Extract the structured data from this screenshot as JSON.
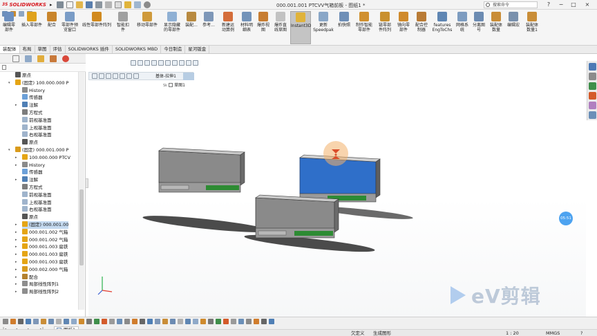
{
  "app": {
    "brand": "SOLIDWORKS",
    "window_title": "000.001.001 PTCVV气箱前板 - 图纸1 *",
    "search_placeholder": "搜索命令",
    "window_controls": [
      "?",
      "−",
      "□",
      "×"
    ]
  },
  "ribbon": {
    "buttons": [
      {
        "label": "编辑零\n部件",
        "icon": "edit-component-icon",
        "color": "#6c8fbf"
      },
      {
        "label": "插入零部件",
        "icon": "insert-components-icon",
        "color": "#e0a21c"
      },
      {
        "label": "配合",
        "icon": "mate-icon",
        "color": "#c9852b"
      },
      {
        "label": "零部件预\n览窗口",
        "icon": "component-preview-icon",
        "color": "#7a9cc6"
      },
      {
        "label": "线性零部件阵列",
        "icon": "linear-pattern-icon",
        "color": "#d18a1f"
      },
      {
        "label": "智能扣\n件",
        "icon": "smart-fasteners-icon",
        "color": "#a0a0a0"
      },
      {
        "label": "移动零部件",
        "icon": "move-component-icon",
        "color": "#cf9a3b"
      },
      {
        "label": "显示隐藏\n的零部件",
        "icon": "show-hidden-icon",
        "color": "#8fb0d4"
      },
      {
        "label": "装配...",
        "icon": "assembly-features-icon",
        "color": "#b88a40"
      },
      {
        "label": "参考...",
        "icon": "reference-geometry-icon",
        "color": "#7e97b8"
      },
      {
        "label": "新建运\n动算例",
        "icon": "new-motion-study-icon",
        "color": "#d46d3a"
      },
      {
        "label": "材料明\n细表",
        "icon": "bom-icon",
        "color": "#7393b9"
      },
      {
        "label": "爆炸视\n图",
        "icon": "exploded-view-icon",
        "color": "#c77d32"
      },
      {
        "label": "爆炸直\n线草图",
        "icon": "explode-line-sketch-icon",
        "color": "#c2c2c2"
      },
      {
        "label": "Instant3D",
        "icon": "instant3d-icon",
        "color": "#e0b33a",
        "active": true
      },
      {
        "label": "更新\nSpeedpak",
        "icon": "speedpak-icon",
        "color": "#8aa7c7"
      },
      {
        "label": "拍快照",
        "icon": "snapshot-icon",
        "color": "#6f8fb7"
      },
      {
        "label": "制作智能\n零部件",
        "icon": "smart-component-icon",
        "color": "#d0902f"
      },
      {
        "label": "链零部\n件阵列",
        "icon": "chain-pattern-icon",
        "color": "#c9902e"
      },
      {
        "label": "镜向零\n部件",
        "icon": "mirror-components-icon",
        "color": "#cf8a2c"
      },
      {
        "label": "配合控\n制器",
        "icon": "mate-controller-icon",
        "color": "#b97b35"
      },
      {
        "label": "features\nEngToChs",
        "icon": "features-translate-icon",
        "color": "#5f86b3"
      },
      {
        "label": "网格系\n统",
        "icon": "grid-system-icon",
        "color": "#7d9cc0"
      },
      {
        "label": "分离图\n号",
        "icon": "split-number-icon",
        "color": "#6c8bb2"
      },
      {
        "label": "装配体\n数量",
        "icon": "assembly-count-icon",
        "color": "#c98d37"
      },
      {
        "label": "编辑宏",
        "icon": "edit-macro-icon",
        "color": "#7a91ad"
      },
      {
        "label": "装配体\n数量1",
        "icon": "assembly-count-1-icon",
        "color": "#c98d37"
      }
    ]
  },
  "tabs": [
    {
      "label": "装配体",
      "active": true
    },
    {
      "label": "布局"
    },
    {
      "label": "草图"
    },
    {
      "label": "评估"
    },
    {
      "label": "SOLIDWORKS 插件"
    },
    {
      "label": "SOLIDWORKS MBD"
    },
    {
      "label": "今日制造"
    },
    {
      "label": "星河钣金"
    }
  ],
  "tree": {
    "nodes": [
      {
        "label": "原点",
        "indent": 0,
        "icon": "origin-icon",
        "color": "#555555"
      },
      {
        "label": "(固定) 100.000.000 P",
        "indent": 0,
        "icon": "part-icon",
        "color": "#e5a514",
        "expander": "▾"
      },
      {
        "label": "History",
        "indent": 1,
        "icon": "history-icon",
        "color": "#8a8a8a"
      },
      {
        "label": "传感器",
        "indent": 1,
        "icon": "sensor-icon",
        "color": "#6ca0d8"
      },
      {
        "label": "注解",
        "indent": 1,
        "icon": "annotations-icon",
        "color": "#4f7fb5",
        "expander": "▸"
      },
      {
        "label": "方程式",
        "indent": 1,
        "icon": "equations-icon",
        "color": "#7d7d7d"
      },
      {
        "label": "前视基准面",
        "indent": 1,
        "icon": "plane-icon",
        "color": "#9fb4cc"
      },
      {
        "label": "上视基准面",
        "indent": 1,
        "icon": "plane-icon",
        "color": "#9fb4cc"
      },
      {
        "label": "右视基准面",
        "indent": 1,
        "icon": "plane-icon",
        "color": "#9fb4cc"
      },
      {
        "label": "原点",
        "indent": 1,
        "icon": "origin-icon",
        "color": "#555555"
      },
      {
        "label": "(固定) 000.001.000 P",
        "indent": 0,
        "icon": "subassembly-icon",
        "color": "#d99b1c",
        "expander": "▾"
      },
      {
        "label": "100.000.000 PTCV",
        "indent": 1,
        "icon": "part-icon",
        "color": "#e5a514",
        "expander": "▸"
      },
      {
        "label": "History",
        "indent": 1,
        "icon": "history-icon",
        "color": "#8a8a8a",
        "expander": "▸"
      },
      {
        "label": "传感器",
        "indent": 1,
        "icon": "sensor-icon",
        "color": "#6ca0d8"
      },
      {
        "label": "注解",
        "indent": 1,
        "icon": "annotations-icon",
        "color": "#4f7fb5",
        "expander": "▸"
      },
      {
        "label": "方程式",
        "indent": 1,
        "icon": "equations-icon",
        "color": "#7d7d7d"
      },
      {
        "label": "前视基准面",
        "indent": 1,
        "icon": "plane-icon",
        "color": "#9fb4cc"
      },
      {
        "label": "上视基准面",
        "indent": 1,
        "icon": "plane-icon",
        "color": "#9fb4cc"
      },
      {
        "label": "右视基准面",
        "indent": 1,
        "icon": "plane-icon",
        "color": "#9fb4cc"
      },
      {
        "label": "原点",
        "indent": 1,
        "icon": "origin-icon",
        "color": "#555555"
      },
      {
        "label": "(固定) 000.001.00",
        "indent": 1,
        "icon": "part-icon",
        "color": "#e5a514",
        "expander": "▸",
        "selected": true
      },
      {
        "label": "000.001.002 气箱",
        "indent": 1,
        "icon": "part-icon",
        "color": "#e5a514",
        "expander": "▸"
      },
      {
        "label": "000.001.002 气箱",
        "indent": 1,
        "icon": "part-icon",
        "color": "#e5a514",
        "expander": "▸"
      },
      {
        "label": "000.001.003 扁铁",
        "indent": 1,
        "icon": "part-icon",
        "color": "#e5a514",
        "expander": "▸"
      },
      {
        "label": "000.001.003 扁铁",
        "indent": 1,
        "icon": "part-icon",
        "color": "#e5a514",
        "expander": "▸"
      },
      {
        "label": "000.001.003 扁铁",
        "indent": 1,
        "icon": "part-icon",
        "color": "#e5a514",
        "expander": "▸"
      },
      {
        "label": "000.002.000 气箱",
        "indent": 1,
        "icon": "subassembly-icon",
        "color": "#d99b1c",
        "expander": "▸"
      },
      {
        "label": "配合",
        "indent": 1,
        "icon": "mates-folder-icon",
        "color": "#b4822f",
        "expander": "▸"
      },
      {
        "label": "局部线性阵列1",
        "indent": 1,
        "icon": "pattern-icon",
        "color": "#8d8d8d",
        "expander": "▸"
      },
      {
        "label": "局部线性阵列2",
        "indent": 1,
        "icon": "pattern-icon",
        "color": "#8d8d8d",
        "expander": "▸"
      }
    ]
  },
  "viewport": {
    "breadcrumb_label": "基体-拉伸1",
    "sketch_label": "草图1",
    "sketch_prefix": "Sk",
    "time_badge": "05:51",
    "watermark": "eV剪辑"
  },
  "bottom": {
    "sheet_tab": "图纸1"
  },
  "status": {
    "undefined_text": "欠定义",
    "generating_text": "生成图形",
    "scale": "1 : 20",
    "units": "MMGS"
  }
}
